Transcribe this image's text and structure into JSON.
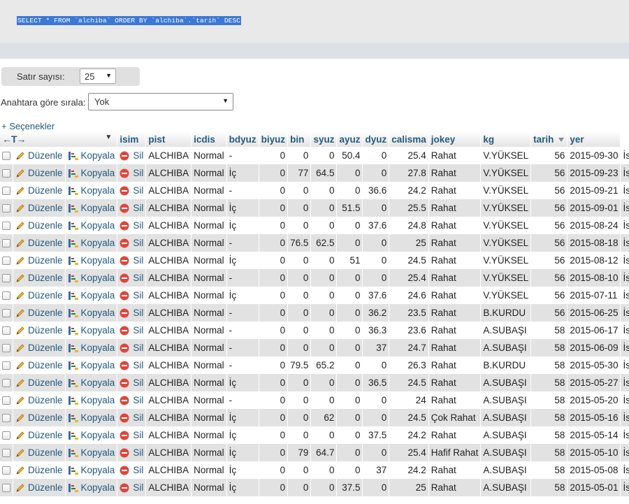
{
  "query": {
    "sql_text": "SELECT * FROM `alchiba` ORDER BY `alchiba`.`tarih` DESC"
  },
  "controls": {
    "rows_label": "Satır sayısı:",
    "rows_value": "25",
    "sort_label": "Anahtara göre sırala:",
    "sort_value": "Yok",
    "options_link": "+ Seçenekler"
  },
  "table": {
    "arrows_label": "←T→",
    "columns": [
      "isim",
      "pist",
      "icdis",
      "bdyuz",
      "biyuz",
      "bin",
      "syuz",
      "ayuz",
      "dyuz",
      "calisma",
      "jokey",
      "kg",
      "tarih",
      "yer"
    ],
    "action_labels": {
      "edit": "Düzenle",
      "copy": "Kopyala",
      "delete": "Sil"
    },
    "rows": [
      [
        "ALCHIBA",
        "Normal",
        "-",
        "0",
        "0",
        "0",
        "50.4",
        "0",
        "25.4",
        "Rahat",
        "V.YÜKSEL",
        "56",
        "2015-09-30",
        "İstanbul"
      ],
      [
        "ALCHIBA",
        "Normal",
        "İç",
        "0",
        "77",
        "64.5",
        "0",
        "0",
        "27.8",
        "Rahat",
        "V.YÜKSEL",
        "56",
        "2015-09-23",
        "İstanbul"
      ],
      [
        "ALCHIBA",
        "Normal",
        "-",
        "0",
        "0",
        "0",
        "0",
        "36.6",
        "24.2",
        "Rahat",
        "V.YÜKSEL",
        "56",
        "2015-09-21",
        "İstanbul"
      ],
      [
        "ALCHIBA",
        "Normal",
        "İç",
        "0",
        "0",
        "0",
        "51.5",
        "0",
        "25.5",
        "Rahat",
        "V.YÜKSEL",
        "56",
        "2015-09-01",
        "İstanbul"
      ],
      [
        "ALCHIBA",
        "Normal",
        "İç",
        "0",
        "0",
        "0",
        "0",
        "37.6",
        "24.8",
        "Rahat",
        "V.YÜKSEL",
        "56",
        "2015-08-24",
        "İstanbul"
      ],
      [
        "ALCHIBA",
        "Normal",
        "-",
        "0",
        "76.5",
        "62.5",
        "0",
        "0",
        "25",
        "Rahat",
        "V.YÜKSEL",
        "56",
        "2015-08-18",
        "İstanbul"
      ],
      [
        "ALCHIBA",
        "Normal",
        "İç",
        "0",
        "0",
        "0",
        "51",
        "0",
        "24.5",
        "Rahat",
        "V.YÜKSEL",
        "56",
        "2015-08-12",
        "İstanbul"
      ],
      [
        "ALCHIBA",
        "Normal",
        "-",
        "0",
        "0",
        "0",
        "0",
        "0",
        "25.4",
        "Rahat",
        "V.YÜKSEL",
        "56",
        "2015-08-10",
        "İstanbul"
      ],
      [
        "ALCHIBA",
        "Normal",
        "İç",
        "0",
        "0",
        "0",
        "0",
        "37.6",
        "24.6",
        "Rahat",
        "V.YÜKSEL",
        "56",
        "2015-07-11",
        "İstanbul"
      ],
      [
        "ALCHIBA",
        "Normal",
        "-",
        "0",
        "0",
        "0",
        "0",
        "36.2",
        "23.5",
        "Rahat",
        "B.KURDU",
        "56",
        "2015-06-25",
        "İstanbul"
      ],
      [
        "ALCHIBA",
        "Normal",
        "-",
        "0",
        "0",
        "0",
        "0",
        "36.3",
        "23.6",
        "Rahat",
        "A.SUBAŞI",
        "58",
        "2015-06-17",
        "İstanbul"
      ],
      [
        "ALCHIBA",
        "Normal",
        "-",
        "0",
        "0",
        "0",
        "0",
        "37",
        "24.7",
        "Rahat",
        "A.SUBAŞI",
        "58",
        "2015-06-09",
        "İstanbul"
      ],
      [
        "ALCHIBA",
        "Normal",
        "-",
        "0",
        "79.5",
        "65.2",
        "0",
        "0",
        "26.3",
        "Rahat",
        "B.KURDU",
        "58",
        "2015-05-30",
        "İstanbul"
      ],
      [
        "ALCHIBA",
        "Normal",
        "İç",
        "0",
        "0",
        "0",
        "0",
        "36.5",
        "24.5",
        "Rahat",
        "A.SUBAŞI",
        "58",
        "2015-05-27",
        "İstanbul"
      ],
      [
        "ALCHIBA",
        "Normal",
        "-",
        "0",
        "0",
        "0",
        "0",
        "0",
        "24",
        "Rahat",
        "A.SUBAŞI",
        "58",
        "2015-05-20",
        "İstanbul"
      ],
      [
        "ALCHIBA",
        "Normal",
        "İç",
        "0",
        "0",
        "62",
        "0",
        "0",
        "24.5",
        "Çok Rahat",
        "A.SUBAŞI",
        "58",
        "2015-05-16",
        "İstanbul"
      ],
      [
        "ALCHIBA",
        "Normal",
        "İç",
        "0",
        "0",
        "0",
        "0",
        "37.5",
        "24.2",
        "Rahat",
        "A.SUBAŞI",
        "58",
        "2015-05-14",
        "İstanbul"
      ],
      [
        "ALCHIBA",
        "Normal",
        "İç",
        "0",
        "79",
        "64.7",
        "0",
        "0",
        "25.4",
        "Hafif Rahat",
        "A.SUBAŞI",
        "58",
        "2015-05-10",
        "İstanbul"
      ],
      [
        "ALCHIBA",
        "Normal",
        "İç",
        "0",
        "0",
        "0",
        "0",
        "37",
        "24.2",
        "Rahat",
        "A.SUBAŞI",
        "58",
        "2015-05-08",
        "İstanbul"
      ],
      [
        "ALCHIBA",
        "Normal",
        "İç",
        "0",
        "0",
        "0",
        "37.5",
        "0",
        "25",
        "Rahat",
        "A.SUBAŞI",
        "58",
        "2015-05-01",
        "İstanbul"
      ]
    ]
  },
  "colors": {
    "link": "#235a81",
    "row_alt": "#e2e2e2",
    "selection": "#3b78d8",
    "delete_icon": "#e0463c"
  },
  "icons": {
    "edit": "pencil-icon",
    "copy": "copy-icon",
    "delete": "delete-icon",
    "sort": "sort-descending-icon",
    "dropdown": "chevron-down-icon"
  }
}
